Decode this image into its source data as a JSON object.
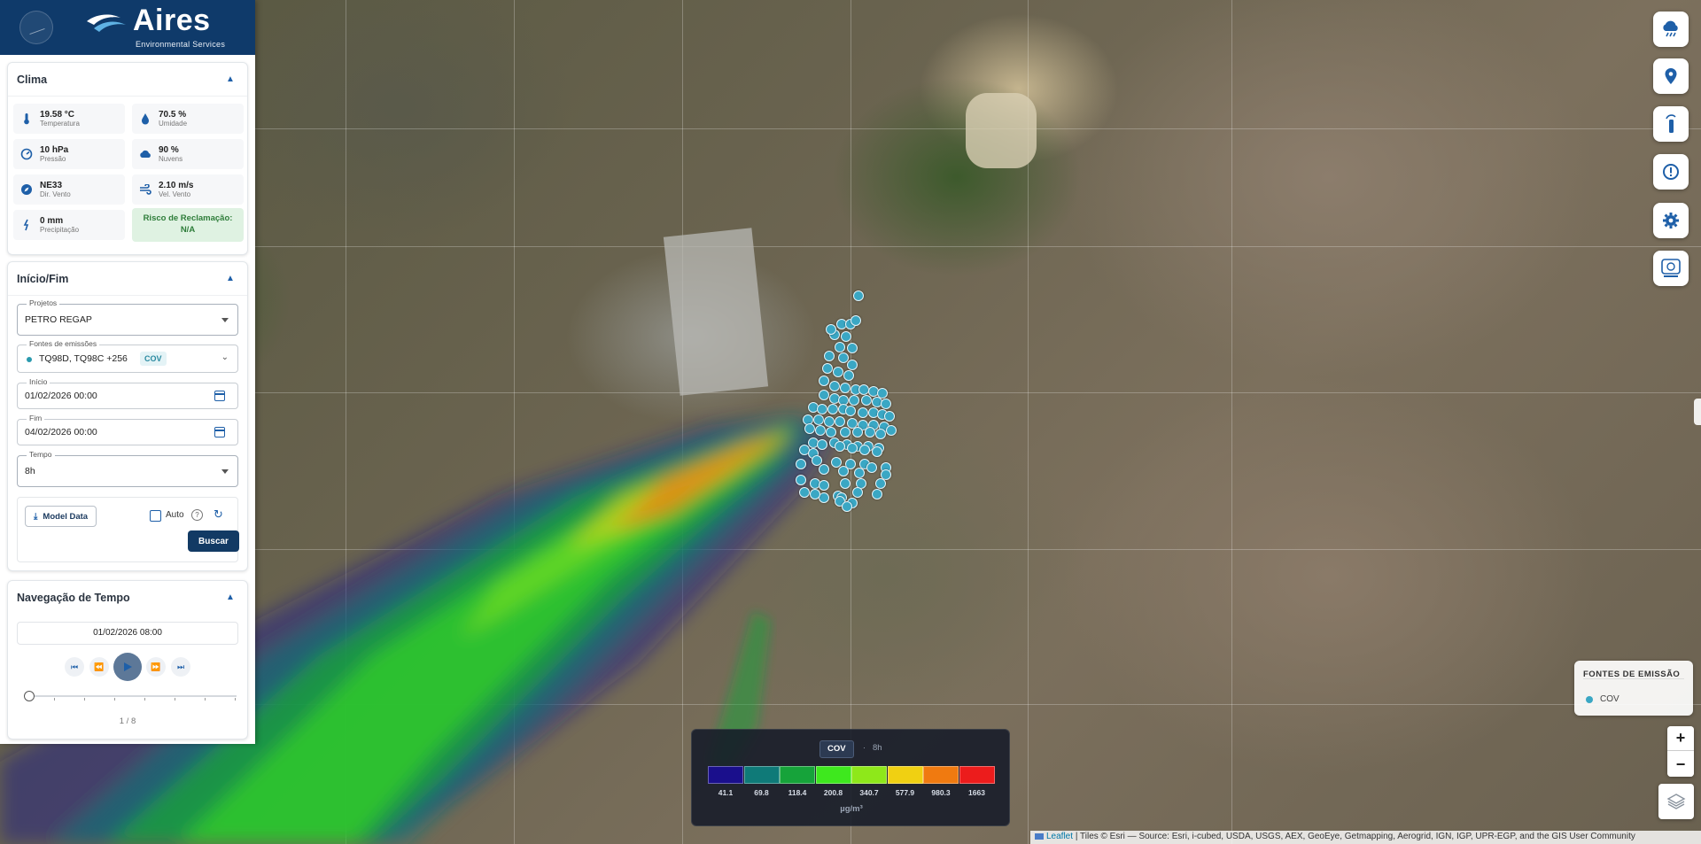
{
  "brand": {
    "name": "Aires",
    "tagline": "Environmental Services"
  },
  "weather": {
    "title": "Clima",
    "items": [
      {
        "value": "19.58 °C",
        "label": "Temperatura",
        "icon": "thermometer-icon"
      },
      {
        "value": "70.5 %",
        "label": "Umidade",
        "icon": "water-drop-icon"
      },
      {
        "value": "10 hPa",
        "label": "Pressão",
        "icon": "gauge-icon"
      },
      {
        "value": "90 %",
        "label": "Nuvens",
        "icon": "cloud-icon"
      },
      {
        "value": "NE33",
        "label": "Dir. Vento",
        "icon": "compass-icon"
      },
      {
        "value": "2.10 m/s",
        "label": "Vel. Vento",
        "icon": "wind-icon"
      },
      {
        "value": "0 mm",
        "label": "Precipitação",
        "icon": "rain-icon"
      }
    ],
    "risk": {
      "label": "Risco de Reclamação:",
      "value": "N/A"
    }
  },
  "period": {
    "title": "Início/Fim",
    "project": {
      "label": "Projetos",
      "value": "PETRO REGAP"
    },
    "sources": {
      "label": "Fontes de emissões",
      "value": "TQ98D, TQ98C +256",
      "badge": "COV"
    },
    "start": {
      "label": "Início",
      "value": "01/02/2026 00:00"
    },
    "end": {
      "label": "Fim",
      "value": "04/02/2026 00:00"
    },
    "time": {
      "label": "Tempo",
      "value": "8h"
    },
    "model_button": "Model Data",
    "auto_label": "Auto",
    "search_button": "Buscar"
  },
  "time_nav": {
    "title": "Navegação de Tempo",
    "current": "01/02/2026 08:00",
    "page": "1 / 8",
    "position": 0
  },
  "sources_legend": {
    "title": "FONTES DE EMISSÃO",
    "items": [
      {
        "label": "COV",
        "color": "#3aa7c4"
      }
    ]
  },
  "scale_legend": {
    "pollutant": "COV",
    "interval": "8h",
    "unit": "µg/m³",
    "stops": [
      {
        "value": "41.1",
        "color": "#1a0f8c"
      },
      {
        "value": "69.8",
        "color": "#0f7a78"
      },
      {
        "value": "118.4",
        "color": "#16a33a"
      },
      {
        "value": "200.8",
        "color": "#3ee81e"
      },
      {
        "value": "340.7",
        "color": "#8ee81a"
      },
      {
        "value": "577.9",
        "color": "#f0d012"
      },
      {
        "value": "980.3",
        "color": "#f07a10"
      },
      {
        "value": "1663",
        "color": "#ec1c1c"
      }
    ]
  },
  "zoom": {
    "in": "+",
    "out": "−"
  },
  "attribution": {
    "leaflet": "Leaflet",
    "text": "| Tiles © Esri — Source: Esri, i-cubed, USDA, USGS, AEX, GeoEye, Getmapping, Aerogrid, IGN, IGP, UPR-EGP, and the GIS User Community"
  },
  "toolbar": [
    "weather-cloud-icon",
    "location-pin-icon",
    "sensor-icon",
    "alert-icon",
    "settings-gear-icon",
    "aires-sensor-icon"
  ],
  "colors": {
    "brand": "#0f3a6a",
    "accent": "#1e5fa8",
    "marker": "#3aa7c4"
  }
}
